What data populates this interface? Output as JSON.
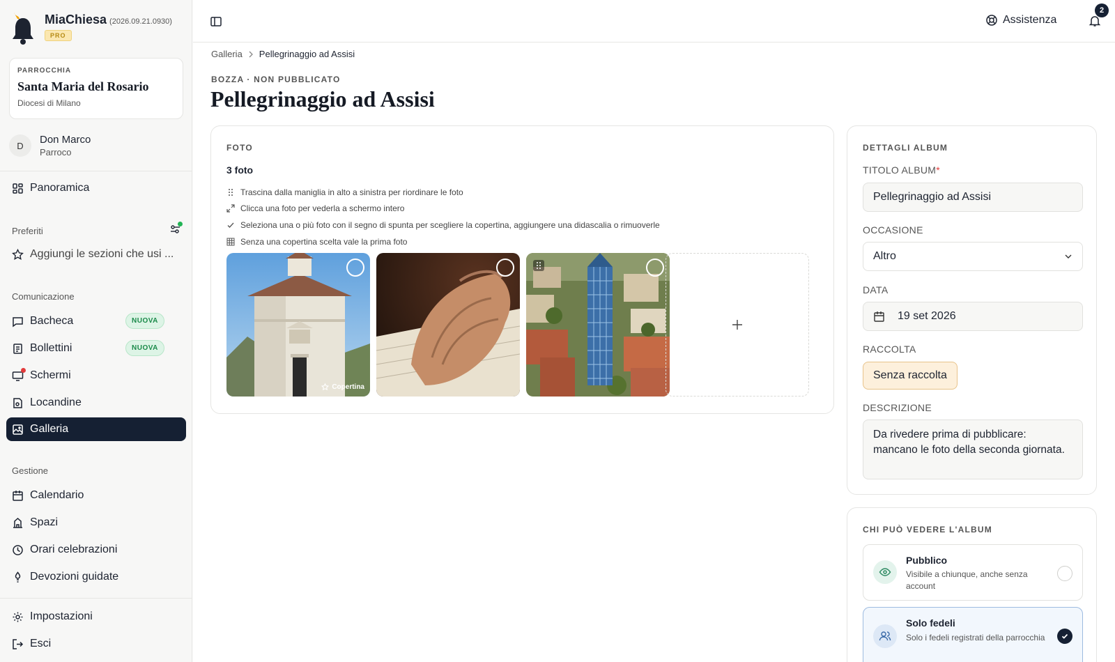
{
  "app": {
    "name": "MiaChiesa",
    "version": "(2026.09.21.0930)",
    "plan_badge": "PRO"
  },
  "parish": {
    "kicker": "PARROCCHIA",
    "name": "Santa Maria del Rosario",
    "diocese": "Diocesi di Milano"
  },
  "user": {
    "initial": "D",
    "name": "Don Marco",
    "role": "Parroco"
  },
  "sidebar": {
    "overview": "Panoramica",
    "favorites_heading": "Preferiti",
    "favorites_add": "Aggiungi le sezioni che usi ...",
    "communication_heading": "Comunicazione",
    "communication": [
      {
        "label": "Bacheca",
        "badge": "NUOVA"
      },
      {
        "label": "Bollettini",
        "badge": "NUOVA"
      },
      {
        "label": "Schermi"
      },
      {
        "label": "Locandine"
      },
      {
        "label": "Galleria"
      }
    ],
    "management_heading": "Gestione",
    "management": [
      {
        "label": "Calendario"
      },
      {
        "label": "Spazi"
      },
      {
        "label": "Orari celebrazioni"
      },
      {
        "label": "Devozioni guidate"
      }
    ],
    "settings": "Impostazioni",
    "logout": "Esci",
    "active_item": "Galleria"
  },
  "topbar": {
    "help_label": "Assistenza",
    "notifications_count": "2"
  },
  "breadcrumb": {
    "parent": "Galleria",
    "current": "Pellegrinaggio ad Assisi"
  },
  "page": {
    "status": "BOZZA · NON PUBBLICATO",
    "title": "Pellegrinaggio ad Assisi"
  },
  "photos": {
    "heading": "FOTO",
    "count": "3 foto",
    "hints": [
      "Trascina dalla maniglia in alto a sinistra per riordinare le foto",
      "Clicca una foto per vederla a schermo intero",
      "Seleziona una o più foto con il segno di spunta per scegliere la copertina, aggiungere una didascalia o rimuoverle",
      "Senza una copertina scelta vale la prima foto"
    ],
    "cover_label": "Copertina",
    "items": [
      "chapel",
      "praying-hands",
      "bell-tower"
    ]
  },
  "details": {
    "heading": "DETTAGLI ALBUM",
    "title_label": "TITOLO ALBUM",
    "required_mark": "*",
    "title_value": "Pellegrinaggio ad Assisi",
    "occasion_label": "OCCASIONE",
    "occasion_value": "Altro",
    "date_label": "DATA",
    "date_value": "19 set 2026",
    "collection_label": "RACCOLTA",
    "collection_value": "Senza raccolta",
    "description_label": "DESCRIZIONE",
    "description_value": "Da rivedere prima di pubblicare: mancano le foto della seconda giornata."
  },
  "visibility": {
    "heading": "CHI PUÒ VEDERE L'ALBUM",
    "options": [
      {
        "title": "Pubblico",
        "subtitle": "Visibile a chiunque, anche senza account",
        "selected": false
      },
      {
        "title": "Solo fedeli",
        "subtitle": "Solo i fedeli registrati della parrocchia",
        "selected": true
      }
    ]
  },
  "colors": {
    "accent_dark": "#152033",
    "new_badge": "#1b8a4a",
    "alert_red": "#e23b3b",
    "online_green": "#22b455",
    "collection_bg": "#fdf0dc"
  }
}
